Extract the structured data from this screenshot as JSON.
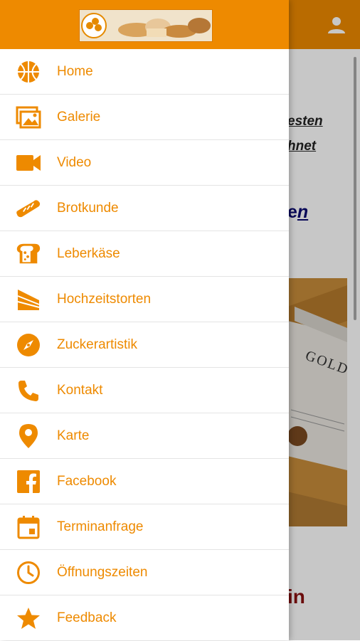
{
  "colors": {
    "accent": "#ee8a00",
    "drawer_bg": "#ffffff",
    "divider": "#e4e4e4"
  },
  "logo": {
    "icon": "bakery-logo-banner"
  },
  "header": {
    "user_icon": "user-icon"
  },
  "menu": [
    {
      "label": "Home",
      "icon": "basketball-icon"
    },
    {
      "label": "Galerie",
      "icon": "gallery-icon"
    },
    {
      "label": "Video",
      "icon": "video-camera-icon"
    },
    {
      "label": "Brotkunde",
      "icon": "baguette-icon"
    },
    {
      "label": "Leberkäse",
      "icon": "bread-slice-icon"
    },
    {
      "label": "Hochzeitstorten",
      "icon": "cake-slice-icon"
    },
    {
      "label": "Zuckerartistik",
      "icon": "compass-icon"
    },
    {
      "label": "Kontakt",
      "icon": "phone-icon"
    },
    {
      "label": "Karte",
      "icon": "map-pin-icon"
    },
    {
      "label": "Facebook",
      "icon": "facebook-icon"
    },
    {
      "label": "Terminanfrage",
      "icon": "calendar-icon"
    },
    {
      "label": "Öffnungszeiten",
      "icon": "clock-icon"
    },
    {
      "label": "Feedback",
      "icon": "star-icon"
    }
  ],
  "background": {
    "line1": "esten",
    "line2": "hnet",
    "line3_prefix": "e",
    "line3_link": "n",
    "photo_text": "GOLD",
    "line4": "in"
  }
}
